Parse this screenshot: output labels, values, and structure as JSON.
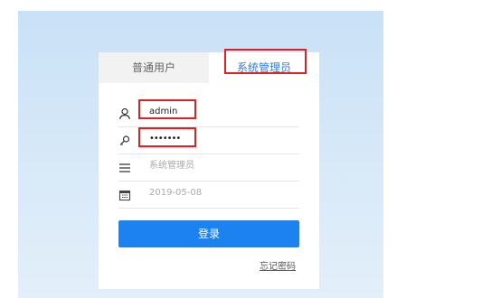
{
  "tabs": {
    "normal_user": "普通用户",
    "admin": "系统管理员"
  },
  "form": {
    "username": "admin",
    "password_mask": "•••••••",
    "role": "系统管理员",
    "date": "2019-05-08"
  },
  "login_button": "登录",
  "forgot_password": "忘记密码",
  "colors": {
    "accent": "#1c82ef",
    "highlight": "#e02020",
    "active_tab_text": "#2e7ce0"
  },
  "icons": {
    "username": "user-icon",
    "password": "key-icon",
    "role": "menu-icon",
    "date": "calendar-icon"
  }
}
